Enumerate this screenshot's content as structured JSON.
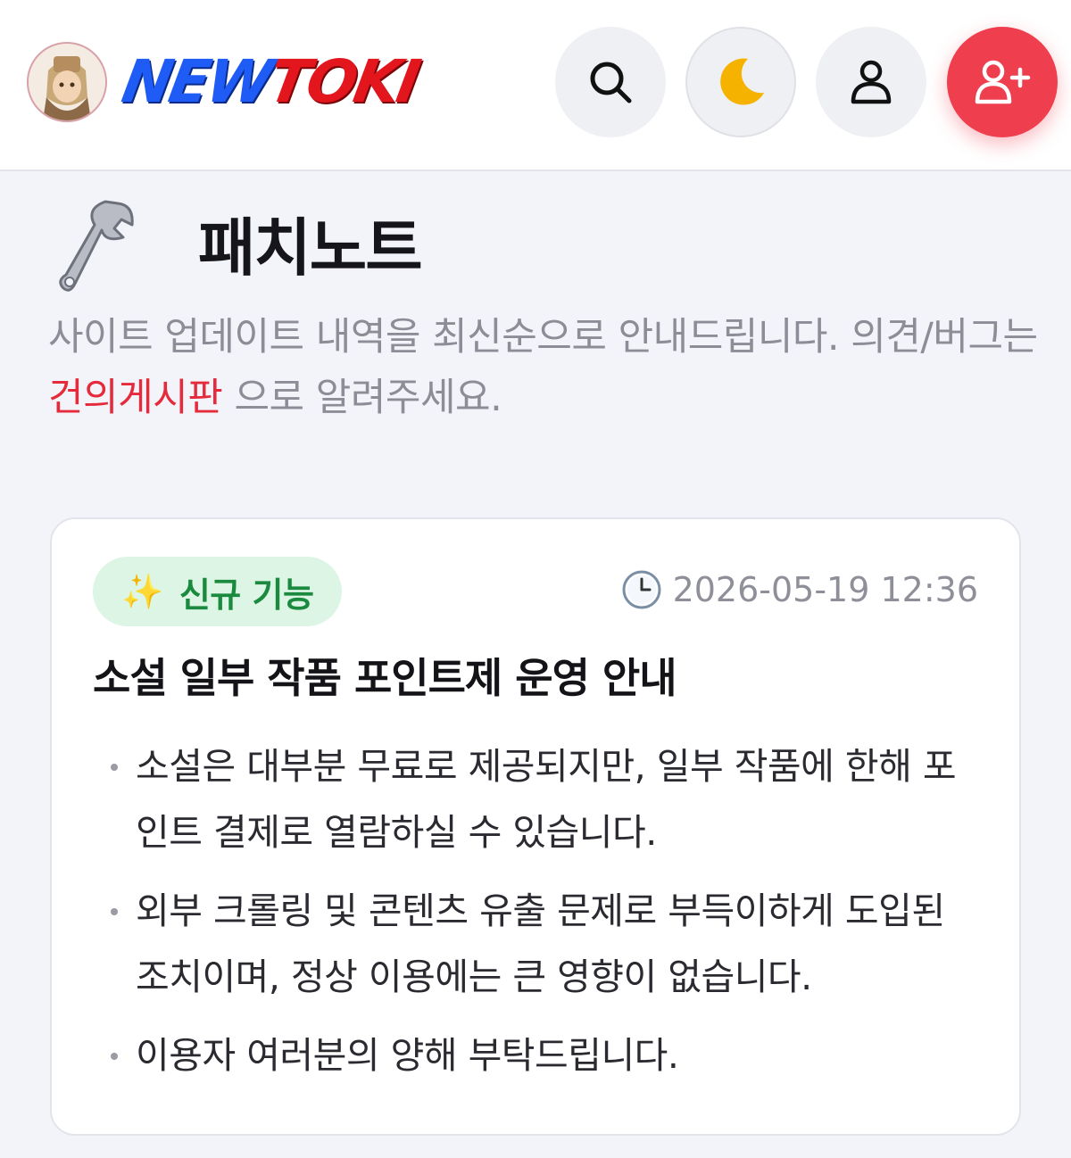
{
  "header": {
    "logo_new": "NEW",
    "logo_toki": "TOKI",
    "buttons": {
      "search_icon": "search-icon",
      "theme_icon": "moon-icon",
      "login_icon": "user-icon",
      "signup_icon": "user-plus-icon"
    },
    "colors": {
      "brand_blue": "#1e5cf5",
      "brand_red": "#e4161d",
      "signup_bg": "#ef3f4f"
    }
  },
  "page": {
    "title_icon": "wrench-icon",
    "title": "패치노트",
    "description_before": "사이트 업데이트 내역을 최신순으로 안내드립니다. 의견/버그는 ",
    "description_link": "건의게시판",
    "description_after": " 으로 알려주세요."
  },
  "patch_note": {
    "badge_icon": "sparkles-icon",
    "badge_label": "신규 기능",
    "timestamp_icon": "clock-icon",
    "timestamp": "2026-05-19 12:36",
    "title": "소설 일부 작품 포인트제 운영 안내",
    "items": [
      "소설은 대부분 무료로 제공되지만, 일부 작품에 한해 포인트 결제로 열람하실 수 있습니다.",
      "외부 크롤링 및 콘텐츠 유출 문제로 부득이하게 도입된 조치이며, 정상 이용에는 큰 영향이 없습니다.",
      "이용자 여러분의 양해 부탁드립니다."
    ]
  }
}
